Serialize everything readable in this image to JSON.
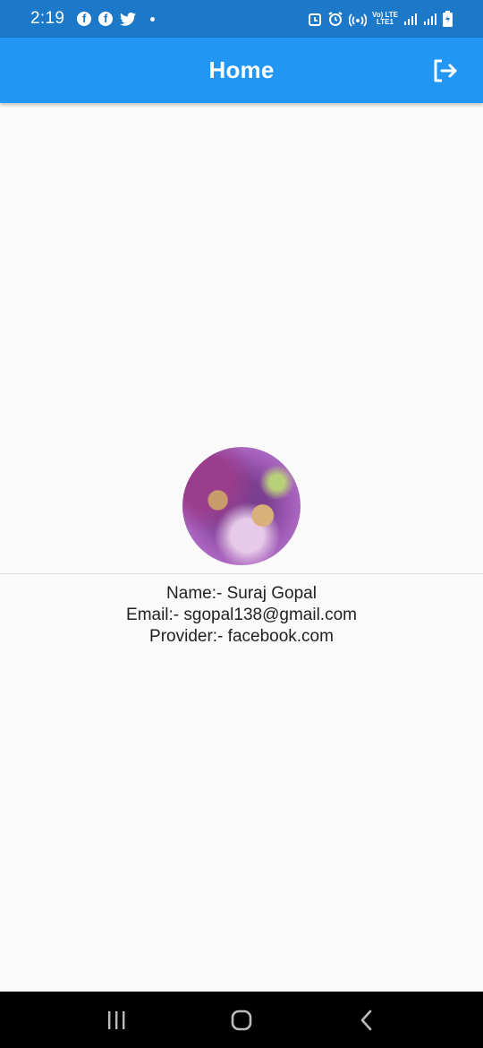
{
  "status_bar": {
    "time": "2:19",
    "notification_icons": [
      "facebook-icon",
      "facebook-icon",
      "twitter-icon",
      "dot"
    ],
    "network_label_top": "Vo) LTE",
    "network_label_bottom": "LTE1",
    "system_icons": [
      "alarm-icon",
      "hotspot-icon",
      "signal-icon",
      "signal-icon",
      "battery-charging-icon"
    ]
  },
  "app_bar": {
    "title": "Home",
    "action_icon": "logout-icon",
    "color": "#2196f3"
  },
  "profile": {
    "name_line": "Name:- Suraj Gopal",
    "email_line": "Email:- sgopal138@gmail.com",
    "provider_line": "Provider:- facebook.com"
  },
  "nav_bar": {
    "buttons": [
      "recents-icon",
      "home-icon",
      "back-icon"
    ]
  }
}
